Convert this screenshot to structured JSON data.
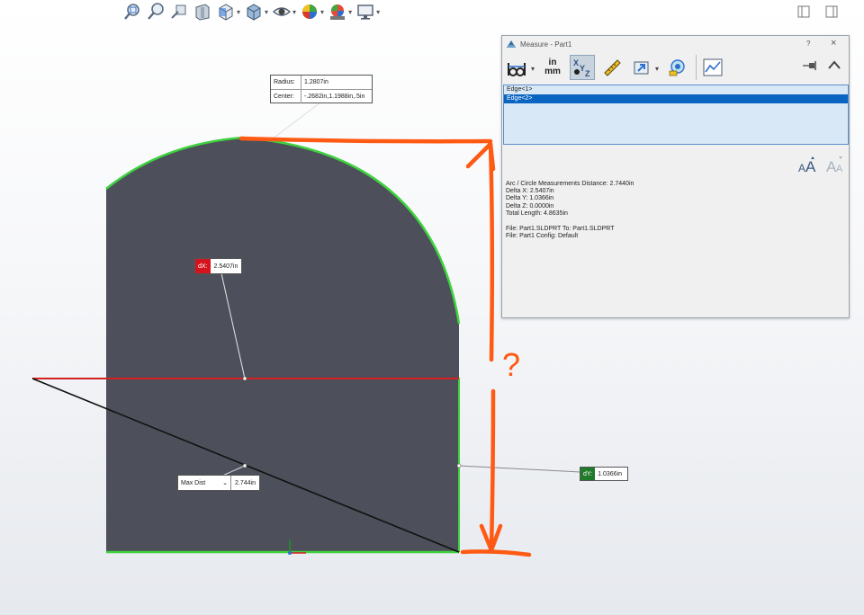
{
  "toolbar": {
    "icons": [
      "zoom-to-fit-icon",
      "zoom-to-area-icon",
      "previous-view-icon",
      "section-view-icon",
      "view-orientation-icon",
      "display-style-icon",
      "hide-show-items-icon",
      "edit-appearance-icon",
      "apply-scene-icon",
      "view-settings-icon"
    ]
  },
  "graphics": {
    "colors": {
      "body": "#4d505a",
      "edge": "#3fd23f",
      "red": "#d42020",
      "annotation": "#ff5a14"
    },
    "radius_callout": {
      "radius_label": "Radius:",
      "radius_value": "1.2807in",
      "center_label": "Center:",
      "center_value": "-.2682in,1.1988in,.5in"
    },
    "dx_callout": {
      "tag": "dX:",
      "value": "2.5407in"
    },
    "dy_callout": {
      "tag": "dY:",
      "value": "1.0366in"
    },
    "max_dist": {
      "option": "Max Dist",
      "value": "2.744in"
    },
    "annotation_text": "?"
  },
  "dialog": {
    "title": "Measure - Part1",
    "help": "?",
    "close": "×",
    "units": {
      "top": "in",
      "bottom": "mm"
    },
    "selections": [
      "Edge<1>",
      "Edge<2>"
    ],
    "selected_index": 1,
    "results": {
      "line1": "Arc / Circle Measurements Distance: 2.7440in",
      "line2": "Delta X: 2.5407in",
      "line3": "Delta Y: 1.0366in",
      "line4": "Delta Z: 0.0000in",
      "line5": "Total Length: 4.8635in",
      "line6": "File: Part1.SLDPRT To: Part1.SLDPRT",
      "line7": "File: Part1 Config: Default"
    }
  }
}
